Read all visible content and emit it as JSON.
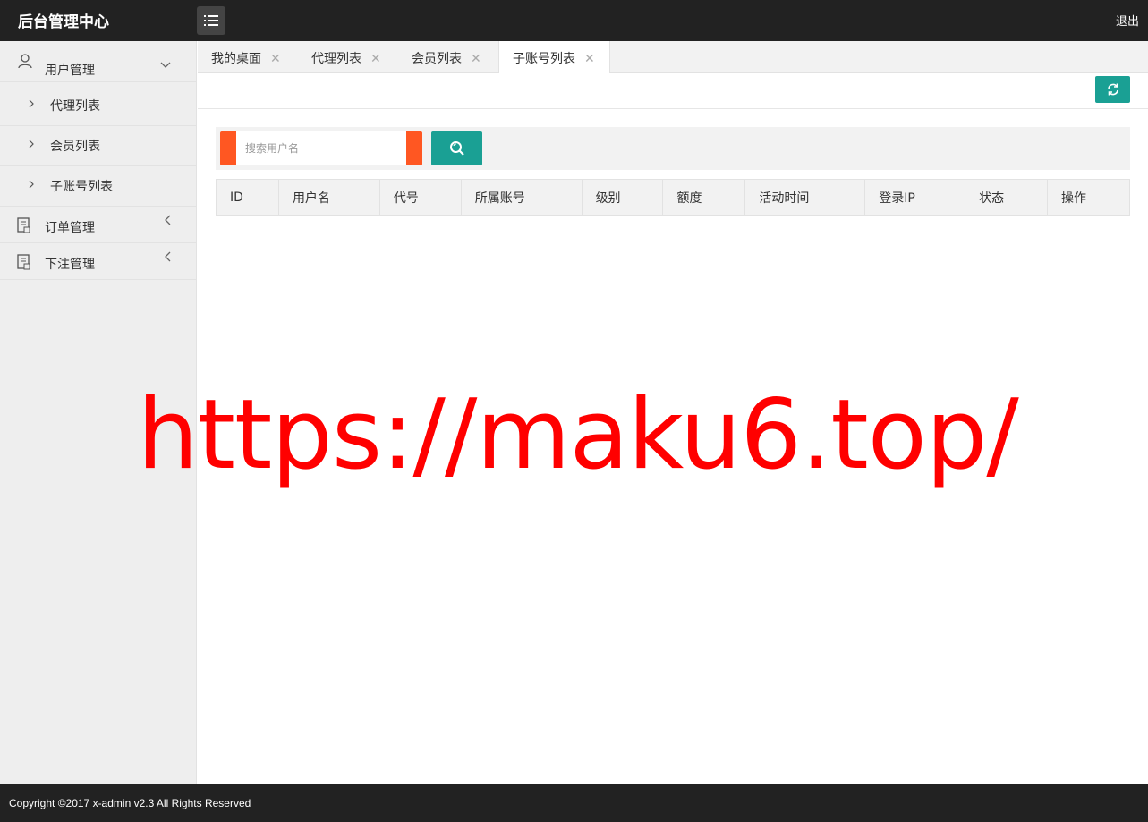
{
  "header": {
    "title": "后台管理中心",
    "logout": "退出"
  },
  "sidebar": {
    "groups": [
      {
        "label": "用户管理",
        "icon": "user-icon",
        "expanded": true,
        "items": [
          {
            "label": "代理列表"
          },
          {
            "label": "会员列表"
          },
          {
            "label": "子账号列表"
          }
        ]
      },
      {
        "label": "订单管理",
        "icon": "document-icon",
        "expanded": false
      },
      {
        "label": "下注管理",
        "icon": "document-icon",
        "expanded": false
      }
    ]
  },
  "tabs": [
    {
      "label": "我的桌面"
    },
    {
      "label": "代理列表"
    },
    {
      "label": "会员列表"
    },
    {
      "label": "子账号列表",
      "active": true
    }
  ],
  "search": {
    "placeholder": "搜索用户名",
    "value": ""
  },
  "table": {
    "columns": [
      "ID",
      "用户名",
      "代号",
      "所属账号",
      "级别",
      "额度",
      "活动时间",
      "登录IP",
      "状态",
      "操作"
    ],
    "rows": []
  },
  "watermark": "https://maku6.top/",
  "footer": {
    "copyright": "Copyright ©2017 x-admin v2.3 All Rights Reserved"
  },
  "colors": {
    "header_bg": "#222222",
    "accent": "#1aa094",
    "search_border": "#ff5722",
    "watermark": "#ff0000"
  }
}
